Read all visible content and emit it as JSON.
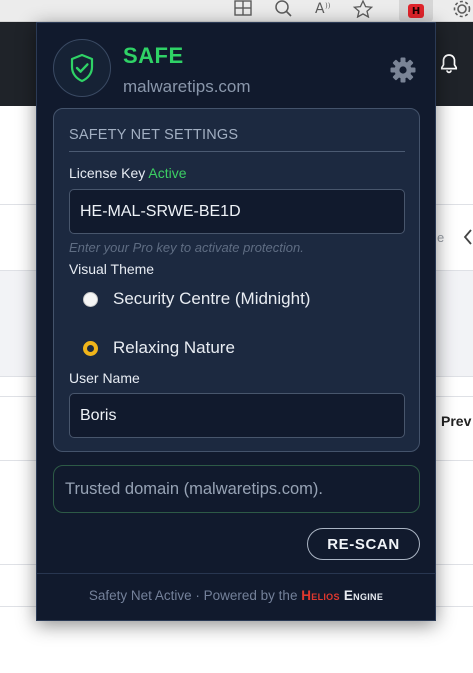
{
  "extension": {
    "badge_letter": "H"
  },
  "popup": {
    "status": "SAFE",
    "domain": "malwaretips.com",
    "settings": {
      "heading": "SAFETY NET SETTINGS",
      "license_label": "License Key",
      "license_status": "Active",
      "license_value": "HE-MAL-SRWE-BE1D",
      "license_hint": "Enter your Pro key to activate protection.",
      "theme_label": "Visual Theme",
      "theme_options": [
        {
          "label": "Security Centre (Midnight)",
          "selected": false
        },
        {
          "label": "Relaxing Nature",
          "selected": true
        }
      ],
      "username_label": "User Name",
      "username_value": "Boris"
    },
    "trusted_message": "Trusted domain (malwaretips.com).",
    "rescan_label": "RE-SCAN",
    "footer_prefix": "Safety Net Active · Powered by the",
    "engine_word1": "Helios",
    "engine_word2": "Engine"
  },
  "background": {
    "partial_text_e": "e",
    "partial_text_prev": "Prev"
  },
  "colors": {
    "safe_green": "#2fd266",
    "active_green": "#3ccf63",
    "radio_selected": "#f0b41a",
    "popup_bg": "#111a2d",
    "panel_bg": "#1c2940",
    "helios_red": "#e0382e"
  },
  "icons": {
    "shield": "shield-check-icon",
    "settings": "gear-icon",
    "bell": "bell-icon"
  }
}
